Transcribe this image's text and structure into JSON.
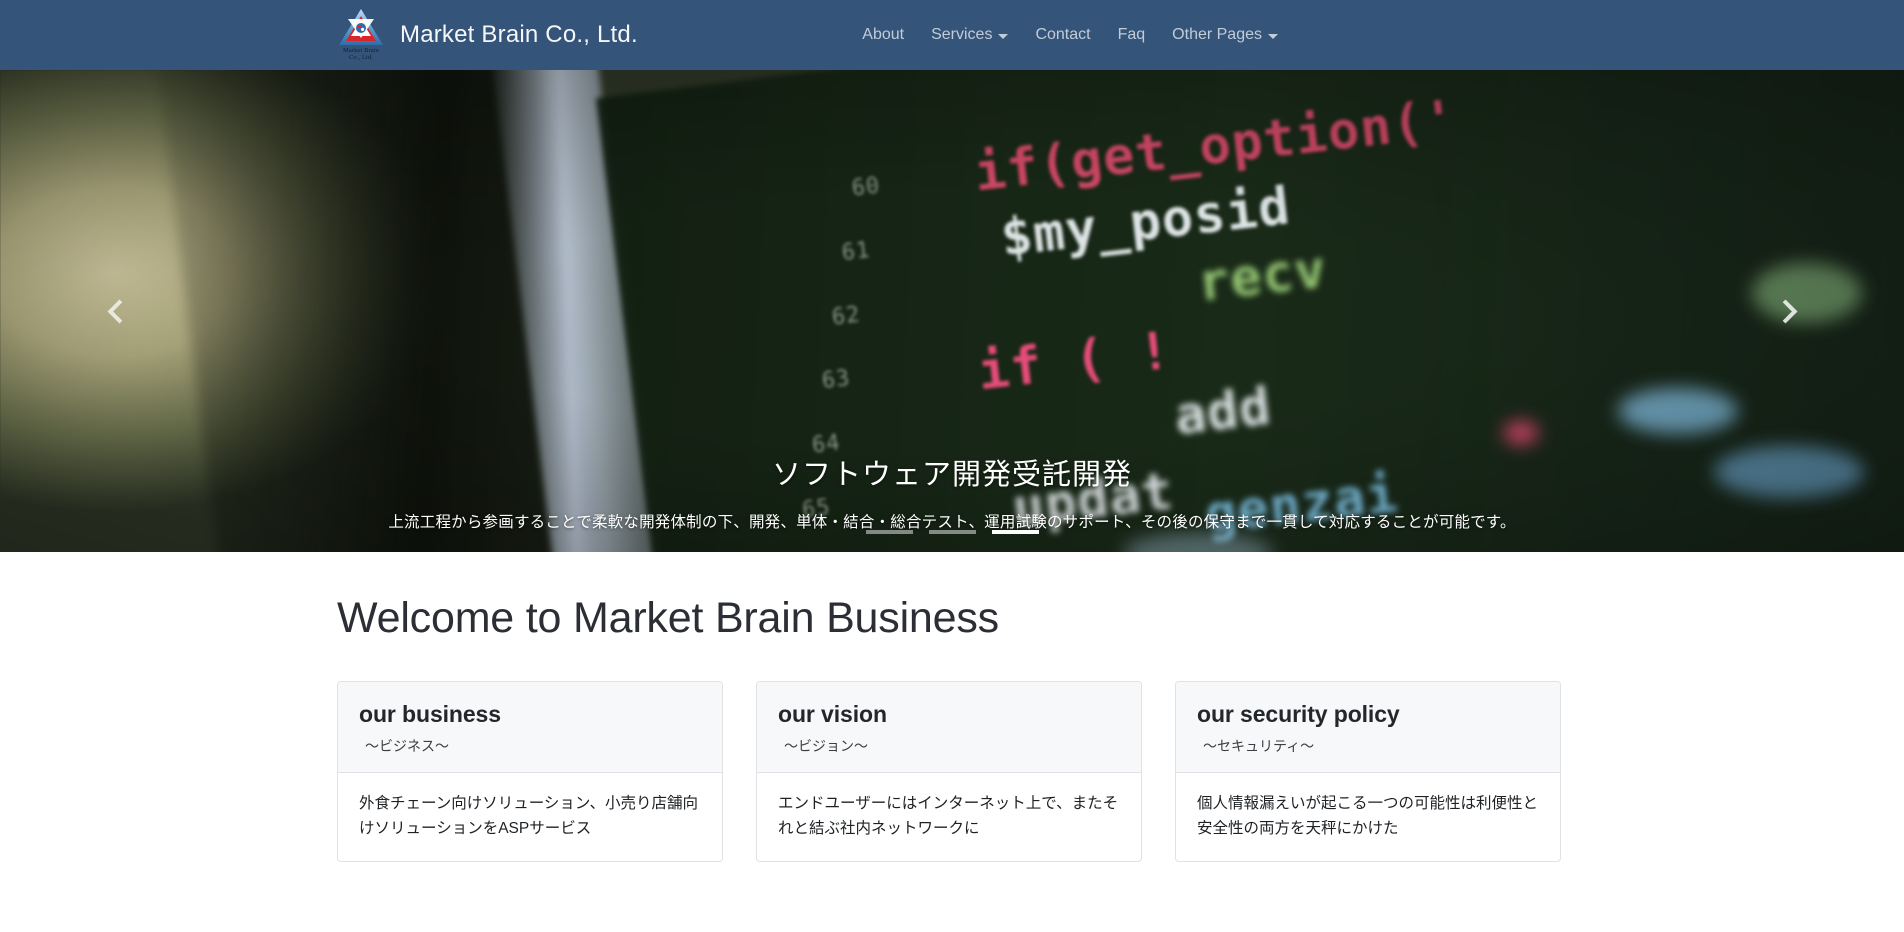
{
  "navbar": {
    "brand_name": "Market Brain Co., Ltd.",
    "logo_caption_line1": "Market Brain",
    "logo_caption_line2": "Co., Ltd.",
    "logo_icon": "triangle-star-logo-icon",
    "links": [
      {
        "label": "About",
        "has_dropdown": false
      },
      {
        "label": "Services",
        "has_dropdown": true
      },
      {
        "label": "Contact",
        "has_dropdown": false
      },
      {
        "label": "Faq",
        "has_dropdown": false
      },
      {
        "label": "Other Pages",
        "has_dropdown": true
      }
    ],
    "background_color": "#35547a",
    "link_color": "#c2ccd8"
  },
  "hero": {
    "caption_title": "ソフトウェア開発受託開発",
    "caption_subtitle": "上流工程から参画することで柔軟な開発体制の下、開発、単体・結合・総合テスト、運用試験のサポート、その後の保守まで一貫して対応することが可能です。",
    "prev_icon": "chevron-left-icon",
    "next_icon": "chevron-right-icon",
    "prev_label": "Previous",
    "next_label": "Next",
    "indicators": [
      {
        "index": "1",
        "active": false
      },
      {
        "index": "2",
        "active": false
      },
      {
        "index": "3",
        "active": true
      }
    ],
    "code_overlay": {
      "line_numbers": [
        "60",
        "61",
        "62",
        "63",
        "64",
        "65"
      ],
      "snippets": [
        "if(get_option('",
        "$my_posid",
        "recv",
        "if ( !",
        "add",
        "updat",
        "genzai"
      ]
    }
  },
  "welcome": {
    "heading": "Welcome to Market Brain Business"
  },
  "cards": [
    {
      "title": "our business",
      "subtitle": "〜ビジネス〜",
      "body": "外食チェーン向けソリューション、小売り店舗向けソリューションをASPサービス"
    },
    {
      "title": "our vision",
      "subtitle": "〜ビジョン〜",
      "body": "エンドユーザーにはインターネット上で、またそれと結ぶ社内ネットワークに"
    },
    {
      "title": "our security policy",
      "subtitle": "〜セキュリティ〜",
      "body": "個人情報漏えいが起こる一つの可能性は利便性と安全性の両方を天秤にかけた"
    }
  ]
}
